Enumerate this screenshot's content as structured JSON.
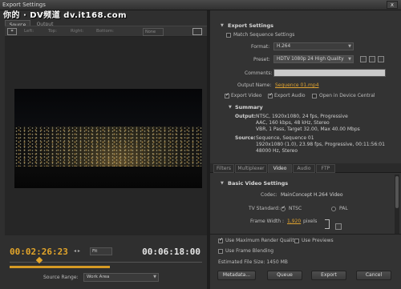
{
  "window": {
    "title": "Export Settings",
    "close_glyph": "x"
  },
  "watermark": "你的 · DV频道 dv.it168.com",
  "left": {
    "tabs": {
      "source": "Source",
      "output": "Output"
    },
    "crop": {
      "icon": "crop-icon",
      "left": "Left:",
      "top": "Top:",
      "right": "Right:",
      "bottom": "Bottom:",
      "scaling": "None"
    },
    "timecode_start": "00:02:26:23",
    "timecode_end": "00:06:18:00",
    "zoom": "Fit",
    "source_range_label": "Source Range:",
    "source_range": "Work Area",
    "work_area_progress": 0.52
  },
  "export_settings": {
    "heading": "Export Settings",
    "match_sequence": "Match Sequence Settings",
    "format_label": "Format:",
    "format": "H.264",
    "preset_label": "Preset:",
    "preset": "HDTV 1080p 24 High Quality",
    "comments_label": "Comments:",
    "output_name_label": "Output Name:",
    "output_name": "Sequence 01.mp4",
    "export_video": "Export Video",
    "export_audio": "Export Audio",
    "open_device_central": "Open in Device Central"
  },
  "summary": {
    "heading": "Summary",
    "output_label": "Output:",
    "output_lines": [
      "NTSC, 1920x1080, 24 fps, Progressive",
      "AAC, 160 kbps, 48 kHz, Stereo",
      "VBR, 1 Pass, Target 32.00, Max 40.00 Mbps"
    ],
    "source_label": "Source:",
    "source_lines": [
      "Sequence, Sequence 01",
      "1920x1080 (1.0), 23.98 fps, Progressive, 00:11:56:01",
      "48000 Hz, Stereo"
    ]
  },
  "panel_tabs": [
    "Filters",
    "Multiplexer",
    "Video",
    "Audio",
    "FTP"
  ],
  "active_tab": "Video",
  "video": {
    "heading": "Basic Video Settings",
    "codec_label": "Codec:",
    "codec": "MainConcept H.264 Video",
    "tv_standard_label": "TV Standard:",
    "ntsc": "NTSC",
    "pal": "PAL",
    "frame_width_label": "Frame Width :",
    "frame_width": "1,920",
    "frame_width_unit": "pixels"
  },
  "bottom": {
    "max_render": "Use Maximum Render Quality",
    "use_previews": "Use Previews",
    "frame_blending": "Use Frame Blending",
    "file_size": "Estimated File Size: 1450 MB",
    "metadata": "Metadata...",
    "queue": "Queue",
    "export": "Export",
    "cancel": "Cancel"
  },
  "colors": {
    "accent": "#e3a52a",
    "panel": "#333333",
    "bg": "#2b2b2b"
  }
}
